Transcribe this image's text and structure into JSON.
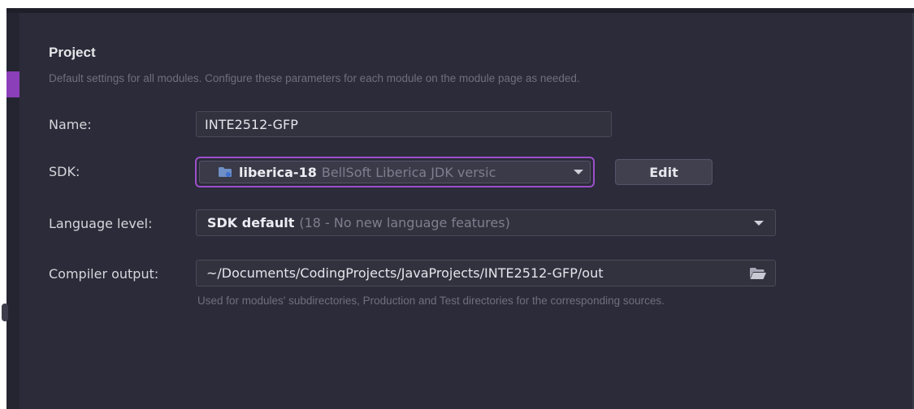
{
  "section": {
    "title": "Project",
    "description": "Default settings for all modules. Configure these parameters for each module on the module page as needed."
  },
  "name_field": {
    "label": "Name:",
    "value": "INTE2512-GFP"
  },
  "sdk_field": {
    "label": "SDK:",
    "selected_name": "liberica-18",
    "selected_detail": "BellSoft Liberica JDK versic",
    "icon": "folder-icon",
    "edit_label": "Edit"
  },
  "language_level": {
    "label": "Language level:",
    "selected_main": "SDK default",
    "selected_detail": "(18 - No new language features)"
  },
  "compiler_output": {
    "label": "Compiler output:",
    "value": "~/Documents/CodingProjects/JavaProjects/INTE2512-GFP/out",
    "browse_icon": "folder-open-icon",
    "hint": "Used for modules' subdirectories, Production and Test directories for the corresponding sources."
  },
  "colors": {
    "panel_background": "#2b2b39",
    "focus_accent": "#9c4fcc",
    "sidebar_accent": "#8b3fb8"
  }
}
